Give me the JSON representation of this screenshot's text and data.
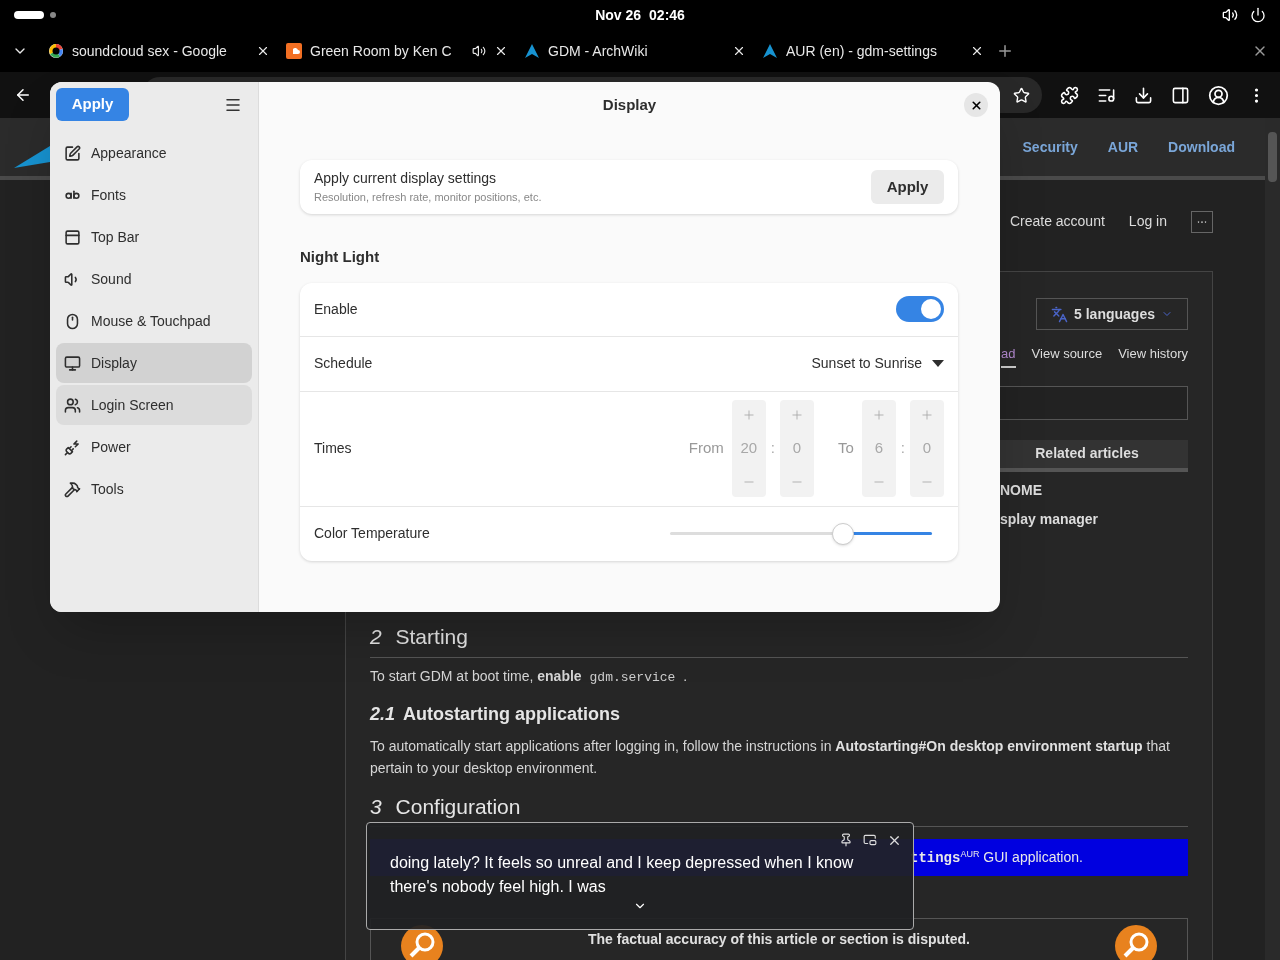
{
  "top_bar": {
    "date": "Nov 26",
    "time": "02:46"
  },
  "browser": {
    "tabs": [
      {
        "title": "soundcloud sex - Google",
        "kind": "google",
        "audio": false
      },
      {
        "title": "Green Room by Ken C",
        "kind": "soundcloud",
        "audio": true
      },
      {
        "title": "GDM - ArchWiki",
        "kind": "arch",
        "audio": false
      },
      {
        "title": "AUR (en) - gdm-settings",
        "kind": "arch",
        "audio": false
      }
    ]
  },
  "page": {
    "nav_links": [
      "Security",
      "AUR",
      "Download"
    ],
    "account_links": [
      "Create account",
      "Log in"
    ],
    "languages": "5 languages",
    "page_tabs": [
      {
        "label": "ad",
        "selected": true
      },
      {
        "label": "View source",
        "selected": false
      },
      {
        "label": "View history",
        "selected": false
      }
    ],
    "related": {
      "title": "Related articles",
      "items": [
        "NOME",
        "splay manager"
      ]
    },
    "sections": [
      {
        "kind": "h2",
        "number": "2",
        "title": "Starting"
      },
      {
        "kind": "para",
        "text": "To start GDM at boot time, **enable**",
        "code": "gdm.service",
        "tail": "."
      },
      {
        "kind": "h3",
        "number": "2.1",
        "title": "Autostarting applications"
      },
      {
        "kind": "para",
        "text": "To automatically start applications after logging in, follow the instructions in",
        "link": "Autostarting#On desktop environment startup",
        "tail": "that pertain to your desktop environment."
      },
      {
        "kind": "h2",
        "number": "3",
        "title": "Configuration"
      },
      {
        "kind": "note",
        "code": "ttings",
        "sup": "AUR",
        "tail": "GUI application."
      },
      {
        "kind": "disputed",
        "text": "The factual accuracy of this article or section is disputed."
      }
    ]
  },
  "dialog": {
    "apply_button": "Apply",
    "title": "Display",
    "sidebar": [
      {
        "label": "Appearance",
        "kind": "appearance",
        "selected": false,
        "hovered": false
      },
      {
        "label": "Fonts",
        "kind": "fonts",
        "selected": false,
        "hovered": false
      },
      {
        "label": "Top Bar",
        "kind": "topbar",
        "selected": false,
        "hovered": false
      },
      {
        "label": "Sound",
        "kind": "sound",
        "selected": false,
        "hovered": false
      },
      {
        "label": "Mouse & Touchpad",
        "kind": "mouse",
        "selected": false,
        "hovered": false
      },
      {
        "label": "Display",
        "kind": "display",
        "selected": true,
        "hovered": false
      },
      {
        "label": "Login Screen",
        "kind": "login",
        "selected": false,
        "hovered": true
      },
      {
        "label": "Power",
        "kind": "power",
        "selected": false,
        "hovered": false
      },
      {
        "label": "Tools",
        "kind": "tools",
        "selected": false,
        "hovered": false
      }
    ],
    "apply_card": {
      "title": "Apply current display settings",
      "subtitle": "Resolution, refresh rate, monitor positions, etc.",
      "button": "Apply"
    },
    "night_light": {
      "heading": "Night Light",
      "enable": {
        "label": "Enable",
        "on": true
      },
      "schedule": {
        "label": "Schedule",
        "value": "Sunset to Sunrise"
      },
      "times": {
        "label": "Times",
        "from_label": "From",
        "from": [
          "20",
          "0"
        ],
        "to_label": "To",
        "to": [
          "6",
          "0"
        ],
        "separator": ":"
      },
      "color_temperature": {
        "label": "Color Temperature",
        "level": 0.34
      }
    }
  },
  "caption": {
    "text": "doing lately? It feels so unreal and I keep depressed when I know there's nobody feel high. I was"
  }
}
